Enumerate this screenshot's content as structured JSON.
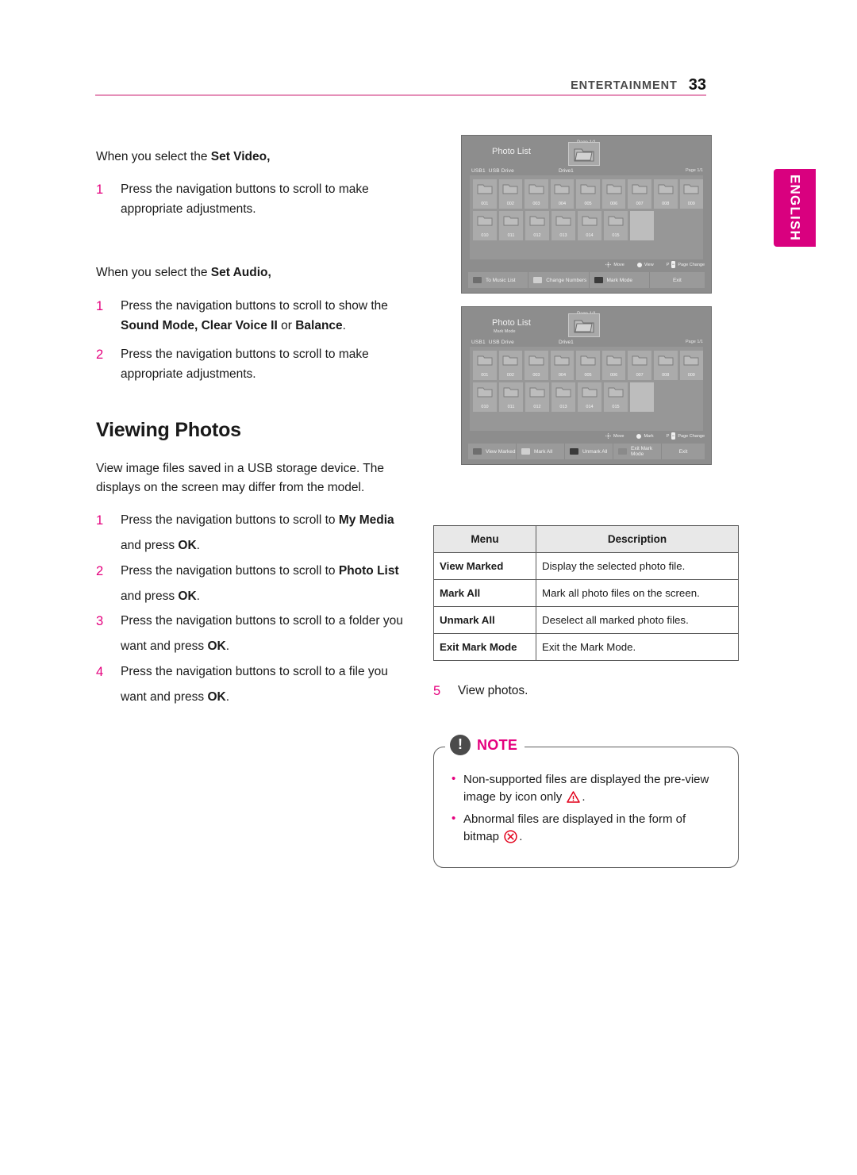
{
  "header": {
    "section": "ENTERTAINMENT",
    "page_number": "33",
    "language_tab": "ENGLISH",
    "accent_color": "#e5007e",
    "rule_color": "#e58fb8"
  },
  "left_column": {
    "set_video": {
      "lead_prefix": "When you select the ",
      "lead_bold": "Set Video,",
      "steps": [
        {
          "num": "1",
          "text": "Press the navigation buttons to scroll to make appropriate adjustments."
        }
      ]
    },
    "set_audio": {
      "lead_prefix": "When you select the ",
      "lead_bold": "Set Audio,",
      "steps": [
        {
          "num": "1",
          "p1": "Press the navigation buttons to scroll to show the ",
          "b1": "Sound Mode, Clear Voice II",
          "p2": " or ",
          "b2": "Balance",
          "p3": "."
        },
        {
          "num": "2",
          "p1": "Press the navigation buttons to scroll to make appropriate adjustments."
        }
      ]
    },
    "viewing_photos": {
      "heading": "Viewing Photos",
      "intro": "View image files saved in a USB storage device. The displays on the screen may differ from the model.",
      "steps": [
        {
          "num": "1",
          "p1": "Press the navigation buttons to scroll to ",
          "b1": "My Media",
          "p2": " and press ",
          "b2": "OK",
          "p3": "."
        },
        {
          "num": "2",
          "p1": "Press the navigation buttons to scroll to ",
          "b1": "Photo List",
          "p2": " and press ",
          "b2": "OK",
          "p3": "."
        },
        {
          "num": "3",
          "p1": "Press the navigation buttons to scroll to a folder you want and press ",
          "b1": "OK",
          "p2": "",
          "b2": "",
          "p3": "."
        },
        {
          "num": "4",
          "p1": "Press the navigation buttons to scroll to a file you want and press ",
          "b1": "OK",
          "p2": "",
          "b2": "",
          "p3": "."
        }
      ]
    }
  },
  "screenshot_one": {
    "title": "Photo List",
    "subtitle": "",
    "page_top": "Page 1/1",
    "usb_label": "USB1",
    "usb_name": "USB Drive",
    "drive_label": "Drive1",
    "page_right": "Page 1/1",
    "folders_row1": [
      "001",
      "002",
      "003",
      "004",
      "005",
      "006",
      "007",
      "008",
      "009"
    ],
    "folders_row2": [
      "010",
      "011",
      "012",
      "013",
      "014",
      "015"
    ],
    "hints": [
      {
        "icon": "dpad-icon",
        "label": "Move"
      },
      {
        "icon": "ok-icon",
        "label": "View"
      },
      {
        "icon": "page-icon",
        "label": "Page Change",
        "prefix": "P"
      }
    ],
    "buttons": [
      {
        "label": "To Music List",
        "swatch": "#6e6e6e"
      },
      {
        "label": "Change Numbers",
        "swatch": "#cfcfcf"
      },
      {
        "label": "Mark Mode",
        "swatch": "#3a3a3a"
      },
      {
        "label": "Exit",
        "swatch": ""
      }
    ]
  },
  "screenshot_two": {
    "title": "Photo List",
    "subtitle": "Mark Mode",
    "page_top": "Page 1/1",
    "usb_label": "USB1",
    "usb_name": "USB Drive",
    "drive_label": "Drive1",
    "page_right": "Page 1/1",
    "folders_row1": [
      "001",
      "002",
      "003",
      "004",
      "005",
      "006",
      "007",
      "008",
      "009"
    ],
    "folders_row2": [
      "010",
      "011",
      "012",
      "013",
      "014",
      "015"
    ],
    "hints": [
      {
        "icon": "dpad-icon",
        "label": "Move"
      },
      {
        "icon": "ok-icon",
        "label": "Mark"
      },
      {
        "icon": "page-icon",
        "label": "Page Change",
        "prefix": "P"
      }
    ],
    "buttons": [
      {
        "label": "View Marked",
        "swatch": "#6e6e6e"
      },
      {
        "label": "Mark All",
        "swatch": "#cfcfcf"
      },
      {
        "label": "Unmark All",
        "swatch": "#3a3a3a"
      },
      {
        "label": "Exit Mark Mode",
        "swatch": "#8a8a8a"
      },
      {
        "label": "Exit",
        "swatch": ""
      }
    ]
  },
  "menu_table": {
    "columns": [
      "Menu",
      "Description"
    ],
    "rows": [
      {
        "menu": "View Marked",
        "description": "Display the selected photo file."
      },
      {
        "menu": "Mark All",
        "description": "Mark all photo files on the screen."
      },
      {
        "menu": "Unmark All",
        "description": "Deselect all marked photo files."
      },
      {
        "menu": "Exit Mark Mode",
        "description": "Exit the Mark Mode."
      }
    ]
  },
  "step_five": {
    "num": "5",
    "text": "View photos."
  },
  "note": {
    "label": "NOTE",
    "items": [
      {
        "p1": "Non-supported files are displayed the pre-view image by icon only ",
        "icon": "warning-triangle-icon",
        "p2": "."
      },
      {
        "p1": "Abnormal files are displayed in the form of bitmap ",
        "icon": "circle-x-icon",
        "p2": "."
      }
    ]
  }
}
